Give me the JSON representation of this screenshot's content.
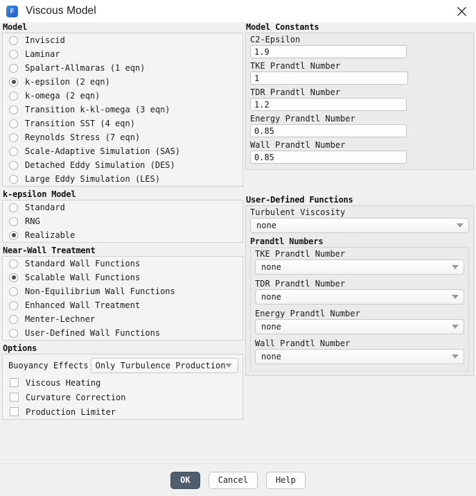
{
  "window": {
    "title": "Viscous Model",
    "app_icon_letter": "F",
    "icon_color": "#2a6fd6",
    "close_icon": "close-icon"
  },
  "model": {
    "title": "Model",
    "options": [
      {
        "label": "Inviscid",
        "selected": false
      },
      {
        "label": "Laminar",
        "selected": false
      },
      {
        "label": "Spalart-Allmaras (1 eqn)",
        "selected": false
      },
      {
        "label": "k-epsilon (2 eqn)",
        "selected": true
      },
      {
        "label": "k-omega (2 eqn)",
        "selected": false
      },
      {
        "label": "Transition k-kl-omega (3 eqn)",
        "selected": false
      },
      {
        "label": "Transition SST (4 eqn)",
        "selected": false
      },
      {
        "label": "Reynolds Stress (7 eqn)",
        "selected": false
      },
      {
        "label": "Scale-Adaptive Simulation (SAS)",
        "selected": false
      },
      {
        "label": "Detached Eddy Simulation (DES)",
        "selected": false
      },
      {
        "label": "Large Eddy Simulation (LES)",
        "selected": false
      }
    ]
  },
  "k_epsilon_model": {
    "title": "k-epsilon Model",
    "options": [
      {
        "label": "Standard",
        "selected": false
      },
      {
        "label": "RNG",
        "selected": false
      },
      {
        "label": "Realizable",
        "selected": true
      }
    ]
  },
  "near_wall_treatment": {
    "title": "Near-Wall Treatment",
    "options": [
      {
        "label": "Standard Wall Functions",
        "selected": false
      },
      {
        "label": "Scalable Wall Functions",
        "selected": true
      },
      {
        "label": "Non-Equilibrium Wall Functions",
        "selected": false
      },
      {
        "label": "Enhanced Wall Treatment",
        "selected": false
      },
      {
        "label": "Menter-Lechner",
        "selected": false
      },
      {
        "label": "User-Defined Wall Functions",
        "selected": false
      }
    ]
  },
  "options": {
    "title": "Options",
    "buoyancy_label": "Buoyancy Effects",
    "buoyancy_value": "Only Turbulence Production",
    "checkboxes": [
      {
        "label": "Viscous Heating",
        "checked": false
      },
      {
        "label": "Curvature Correction",
        "checked": false
      },
      {
        "label": "Production Limiter",
        "checked": false
      }
    ]
  },
  "model_constants": {
    "title": "Model Constants",
    "fields": [
      {
        "label": "C2-Epsilon",
        "value": "1.9"
      },
      {
        "label": "TKE Prandtl Number",
        "value": "1"
      },
      {
        "label": "TDR Prandtl Number",
        "value": "1.2"
      },
      {
        "label": "Energy Prandtl Number",
        "value": "0.85"
      },
      {
        "label": "Wall Prandtl Number",
        "value": "0.85"
      }
    ]
  },
  "udf": {
    "title": "User-Defined Functions",
    "turbulent_viscosity_label": "Turbulent Viscosity",
    "turbulent_viscosity_value": "none",
    "prandtl_title": "Prandtl Numbers",
    "prandtl_fields": [
      {
        "label": "TKE Prandtl Number",
        "value": "none"
      },
      {
        "label": "TDR Prandtl Number",
        "value": "none"
      },
      {
        "label": "Energy Prandtl Number",
        "value": "none"
      },
      {
        "label": "Wall Prandtl Number",
        "value": "none"
      }
    ]
  },
  "footer": {
    "ok_label": "OK",
    "cancel_label": "Cancel",
    "help_label": "Help"
  }
}
